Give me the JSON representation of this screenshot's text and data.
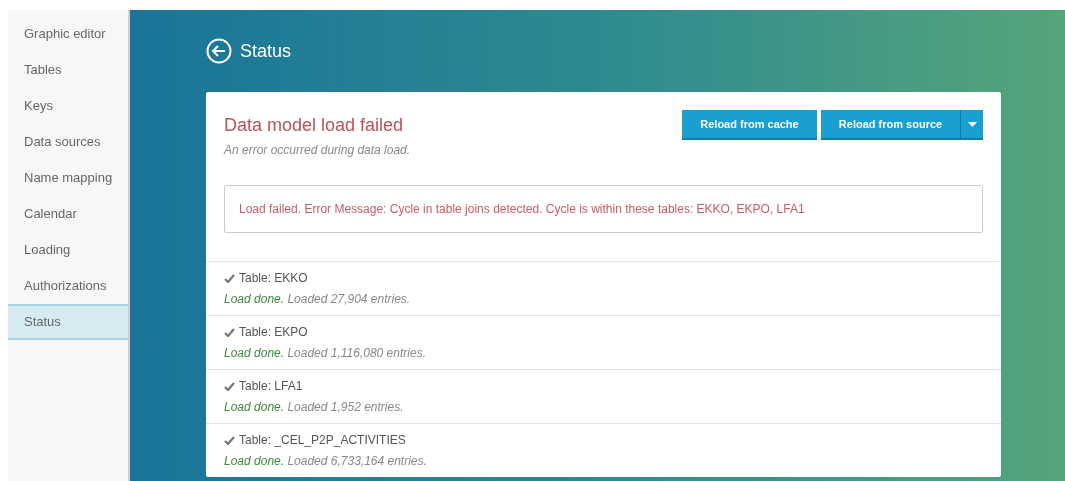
{
  "sidebar": {
    "items": [
      {
        "label": "Graphic editor",
        "selected": false
      },
      {
        "label": "Tables",
        "selected": false
      },
      {
        "label": "Keys",
        "selected": false
      },
      {
        "label": "Data sources",
        "selected": false
      },
      {
        "label": "Name mapping",
        "selected": false
      },
      {
        "label": "Calendar",
        "selected": false
      },
      {
        "label": "Loading",
        "selected": false
      },
      {
        "label": "Authorizations",
        "selected": false
      },
      {
        "label": "Status",
        "selected": true
      }
    ]
  },
  "page_title": "Status",
  "card": {
    "title": "Data model load failed",
    "subtitle": "An error occurred during data load.",
    "buttons": [
      "Reload from cache",
      "Reload from source"
    ],
    "error_message": "Load failed. Error Message: Cycle in table joins detected. Cycle is within these tables: EKKO, EKPO, LFA1",
    "tables": [
      {
        "name": "Table: EKKO",
        "status": "Load done.",
        "kind": "done",
        "detail": "Loaded 27,904 entries."
      },
      {
        "name": "Table: EKPO",
        "status": "Load done.",
        "kind": "done",
        "detail": "Loaded 1,116,080 entries."
      },
      {
        "name": "Table: LFA1",
        "status": "Load done.",
        "kind": "done",
        "detail": "Loaded 1,952 entries."
      },
      {
        "name": "Table: _CEL_P2P_ACTIVITIES",
        "status": "Load done.",
        "kind": "done",
        "detail": "Loaded 6,733,164 entries."
      }
    ]
  }
}
